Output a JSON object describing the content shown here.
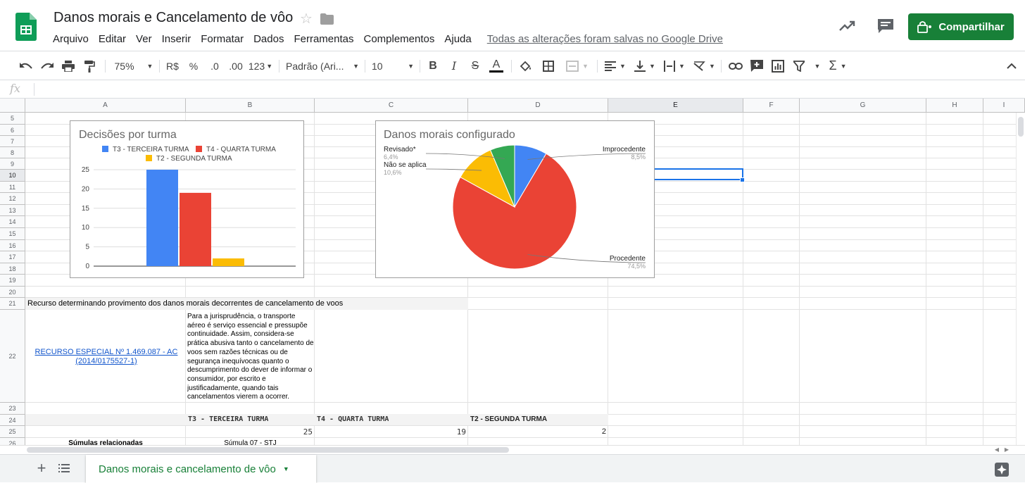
{
  "app": {
    "title": "Danos morais e Cancelamento de vôo",
    "menu": [
      "Arquivo",
      "Editar",
      "Ver",
      "Inserir",
      "Formatar",
      "Dados",
      "Ferramentas",
      "Complementos",
      "Ajuda"
    ],
    "save_status": "Todas as alterações foram salvas no Google Drive",
    "share_label": "Compartilhar",
    "brand_color": "#188038"
  },
  "toolbar": {
    "zoom": "75%",
    "currency": "R$",
    "percent": "%",
    "dec_less": ".0",
    "dec_more": ".00",
    "number_format": "123",
    "font": "Padrão (Ari...",
    "font_size": "10",
    "bold": "B",
    "italic": "I",
    "strike": "S",
    "text_color": "A",
    "sum": "Σ"
  },
  "formula_bar": {
    "fx": "fx",
    "value": ""
  },
  "columns": [
    "A",
    "B",
    "C",
    "D",
    "E",
    "F",
    "G",
    "H",
    "I"
  ],
  "rows": [
    "5",
    "6",
    "7",
    "8",
    "9",
    "10",
    "11",
    "12",
    "13",
    "14",
    "15",
    "16",
    "17",
    "18",
    "19",
    "20",
    "21",
    "22",
    "23",
    "24",
    "25",
    "26"
  ],
  "cells": {
    "a21": "Recurso determinando provimento dos danos morais decorrentes de cancelamento de voos",
    "a22_link": "RECURSO ESPECIAL Nº 1.469.087 - AC (2014/0175527-1)",
    "b22": "Para a jurisprudência, o transporte aéreo é serviço essencial e pressupõe continuidade. Assim, considera-se prática abusiva tanto o cancelamento de voos sem razões técnicas ou de segurança inequívocas quanto o descumprimento do dever de informar o consumidor, por escrito e justificadamente, quando tais cancelamentos vierem a ocorrer.",
    "b24": "T3 - TERCEIRA TURMA",
    "c24": "T4 - QUARTA TURMA",
    "d24": "T2 - SEGUNDA TURMA",
    "b25": "25",
    "c25": "19",
    "d25": "2",
    "a26": "Súmulas relacionadas",
    "b26": "Súmula 07 - STJ"
  },
  "chart_data": [
    {
      "type": "bar",
      "title": "Decisões por turma",
      "categories": [
        ""
      ],
      "series": [
        {
          "name": "T3 - TERCEIRA TURMA",
          "values": [
            25
          ],
          "color": "#4285f4"
        },
        {
          "name": "T4 - QUARTA TURMA",
          "values": [
            19
          ],
          "color": "#ea4335"
        },
        {
          "name": "T2 - SEGUNDA TURMA",
          "values": [
            2
          ],
          "color": "#fbbc04"
        }
      ],
      "ylim": [
        0,
        25
      ],
      "yticks": [
        "0",
        "5",
        "10",
        "15",
        "20",
        "25"
      ],
      "grid": true,
      "legend": "top"
    },
    {
      "type": "pie",
      "title": "Danos morais configurado",
      "slices": [
        {
          "label": "Improcedente",
          "value": 8.5,
          "pct": "8,5%",
          "color": "#4285f4"
        },
        {
          "label": "Procedente",
          "value": 74.5,
          "pct": "74,5%",
          "color": "#ea4335"
        },
        {
          "label": "Não se aplica",
          "value": 10.6,
          "pct": "10,6%",
          "color": "#fbbc04"
        },
        {
          "label": "Revisado*",
          "value": 6.4,
          "pct": "6,4%",
          "color": "#34a853"
        }
      ]
    }
  ],
  "sheet_tab": {
    "name": "Danos morais e cancelamento de vôo"
  }
}
